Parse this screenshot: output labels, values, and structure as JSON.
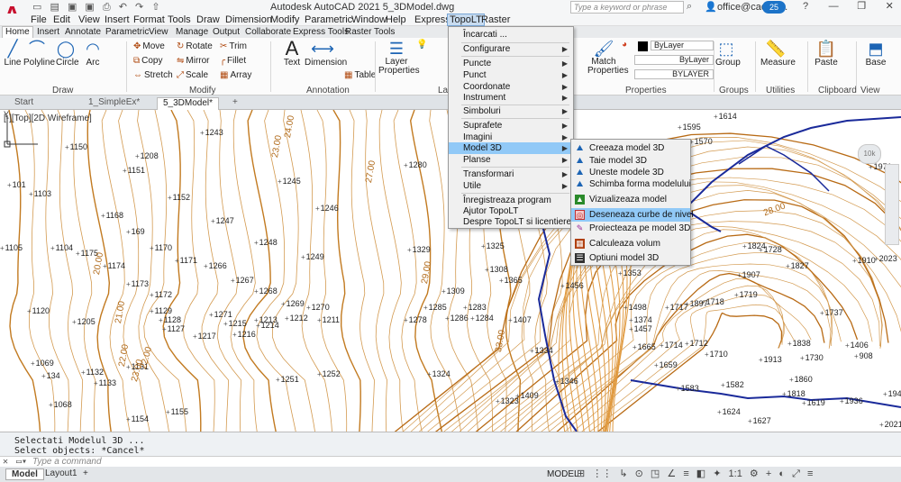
{
  "window": {
    "title": "Autodesk AutoCAD 2021     5_3DModel.dwg",
    "search_placeholder": "Type a keyword or phrase",
    "user": "office@cadwa...",
    "clock_badge": "25"
  },
  "menubar": [
    "File",
    "Edit",
    "View",
    "Insert",
    "Format",
    "Tools",
    "Draw",
    "Dimension",
    "Modify",
    "Parametric",
    "Window",
    "Help",
    "Express",
    "TopoLT",
    "Raster"
  ],
  "ribbon_tabs": [
    "Home",
    "Insert",
    "Annotate",
    "Parametric",
    "View",
    "Manage",
    "Output",
    "Collaborate",
    "Express Tools",
    "Raster Tools"
  ],
  "ribbon": {
    "draw": {
      "line": "Line",
      "polyline": "Polyline",
      "circle": "Circle",
      "arc": "Arc",
      "title": "Draw"
    },
    "modify": {
      "move": "Move",
      "rotate": "Rotate",
      "trim": "Trim",
      "copy": "Copy",
      "mirror": "Mirror",
      "fillet": "Fillet",
      "stretch": "Stretch",
      "scale": "Scale",
      "array": "Array",
      "title": "Modify"
    },
    "annotation": {
      "text": "Text",
      "dimension": "Dimension",
      "table": "Table",
      "title": "Annotation"
    },
    "layers": {
      "layer_properties": "Layer Properties",
      "title": "La"
    },
    "properties": {
      "match": "Match Properties",
      "color": "ByLayer",
      "linetype": "ByLayer",
      "lineweight": "BYLAYER",
      "title": "Properties"
    },
    "groups": {
      "group": "Group",
      "title": "Groups"
    },
    "utilities": {
      "measure": "Measure",
      "title": "Utilities"
    },
    "clipboard": {
      "paste": "Paste",
      "title": "Clipboard"
    },
    "view": {
      "base": "Base",
      "title": "View"
    }
  },
  "doc_tabs": [
    "Start",
    "1_SimpleEx*",
    "5_3DModel*"
  ],
  "viewport_label": "[-][Top][2D Wireframe]",
  "topolt_menu": [
    "Încarcati ...",
    "Configurare",
    "Puncte",
    "Punct",
    "Coordonate",
    "Instrument",
    "Simboluri",
    "Suprafete",
    "Imagini",
    "Model 3D",
    "Planse",
    "Transformari",
    "Utile",
    "Înregistreaza program",
    "Ajutor TopoLT",
    "Despre TopoLT si licentiere"
  ],
  "model3d_submenu": [
    "Creeaza model 3D",
    "Taie model 3D",
    "Uneste modele 3D",
    "Schimba forma modelului",
    "Vizualizeaza model",
    "Deseneaza curbe de nivel",
    "Proiecteaza pe model 3D",
    "Calculeaza volum",
    "Optiuni model 3D"
  ],
  "command": {
    "line1": "Selectati Modelul 3D ...",
    "line2": "Select objects: *Cancel*",
    "placeholder": "Type a command"
  },
  "status": {
    "layouts": [
      "Model",
      "Layout1"
    ],
    "mode": "MODEL",
    "scale": "1:1"
  },
  "points": [
    {
      "t": "1150"
    },
    {
      "t": "1208"
    },
    {
      "t": "1243"
    },
    {
      "t": "1151"
    },
    {
      "t": "1245"
    },
    {
      "t": "1280"
    },
    {
      "t": "101"
    },
    {
      "t": "1152"
    },
    {
      "t": "1103"
    },
    {
      "t": "1246"
    },
    {
      "t": "1168"
    },
    {
      "t": "1247"
    },
    {
      "t": "169"
    },
    {
      "t": "1105"
    },
    {
      "t": "1104"
    },
    {
      "t": "1175"
    },
    {
      "t": "1170"
    },
    {
      "t": "1248"
    },
    {
      "t": "1329"
    },
    {
      "t": "1174"
    },
    {
      "t": "1171"
    },
    {
      "t": "1266"
    },
    {
      "t": "1249"
    },
    {
      "t": "1325"
    },
    {
      "t": "1308"
    },
    {
      "t": "1173"
    },
    {
      "t": "1267"
    },
    {
      "t": "1309"
    },
    {
      "t": "1172"
    },
    {
      "t": "1268"
    },
    {
      "t": "1120"
    },
    {
      "t": "1129"
    },
    {
      "t": "1269"
    },
    {
      "t": "1270"
    },
    {
      "t": "1285"
    },
    {
      "t": "1283"
    },
    {
      "t": "1205"
    },
    {
      "t": "1128"
    },
    {
      "t": "1271"
    },
    {
      "t": "1213"
    },
    {
      "t": "1212"
    },
    {
      "t": "1211"
    },
    {
      "t": "1278"
    },
    {
      "t": "1286"
    },
    {
      "t": "1284"
    },
    {
      "t": "1127"
    },
    {
      "t": "1215"
    },
    {
      "t": "1214"
    },
    {
      "t": "1217"
    },
    {
      "t": "1216"
    },
    {
      "t": "1069"
    },
    {
      "t": "1131"
    },
    {
      "t": "1252"
    },
    {
      "t": "134"
    },
    {
      "t": "1132"
    },
    {
      "t": "1251"
    },
    {
      "t": "1324"
    },
    {
      "t": "1133"
    },
    {
      "t": "1068"
    },
    {
      "t": "1155"
    },
    {
      "t": "1154"
    },
    {
      "t": "1323"
    },
    {
      "t": "1409"
    },
    {
      "t": "1614"
    },
    {
      "t": "1595"
    },
    {
      "t": "1570"
    },
    {
      "t": "1875"
    },
    {
      "t": "1824"
    },
    {
      "t": "1827"
    },
    {
      "t": "1910"
    },
    {
      "t": "1907"
    },
    {
      "t": "1719"
    },
    {
      "t": "1718"
    },
    {
      "t": "1717"
    },
    {
      "t": "1714"
    },
    {
      "t": "1712"
    },
    {
      "t": "1710"
    },
    {
      "t": "1913"
    },
    {
      "t": "1860"
    },
    {
      "t": "1838"
    },
    {
      "t": "1818"
    },
    {
      "t": "1619"
    },
    {
      "t": "1624"
    },
    {
      "t": "1627"
    },
    {
      "t": "1582"
    },
    {
      "t": "1583"
    },
    {
      "t": "1659"
    },
    {
      "t": "1665"
    },
    {
      "t": "1374"
    },
    {
      "t": "1457"
    },
    {
      "t": "1407"
    },
    {
      "t": "1334"
    },
    {
      "t": "1346"
    },
    {
      "t": "1456"
    },
    {
      "t": "1498"
    },
    {
      "t": "1353"
    },
    {
      "t": "1365"
    },
    {
      "t": "1406"
    },
    {
      "t": "908"
    },
    {
      "t": "1936"
    },
    {
      "t": "1945"
    },
    {
      "t": "2021"
    },
    {
      "t": "2023"
    },
    {
      "t": "1971"
    },
    {
      "t": "1897"
    },
    {
      "t": "1737"
    },
    {
      "t": "1728"
    },
    {
      "t": "1730"
    },
    {
      "t": "1875"
    },
    {
      "t": "1912"
    },
    {
      "t": "1882"
    }
  ],
  "contour_labels": [
    {
      "t": "24.00"
    },
    {
      "t": "23.00"
    },
    {
      "t": "22.00"
    },
    {
      "t": "21.00"
    },
    {
      "t": "20.00"
    },
    {
      "t": "27.00"
    },
    {
      "t": "29.00"
    },
    {
      "t": "33.00"
    },
    {
      "t": "28.00"
    },
    {
      "t": "23.00"
    },
    {
      "t": "22.00"
    }
  ]
}
